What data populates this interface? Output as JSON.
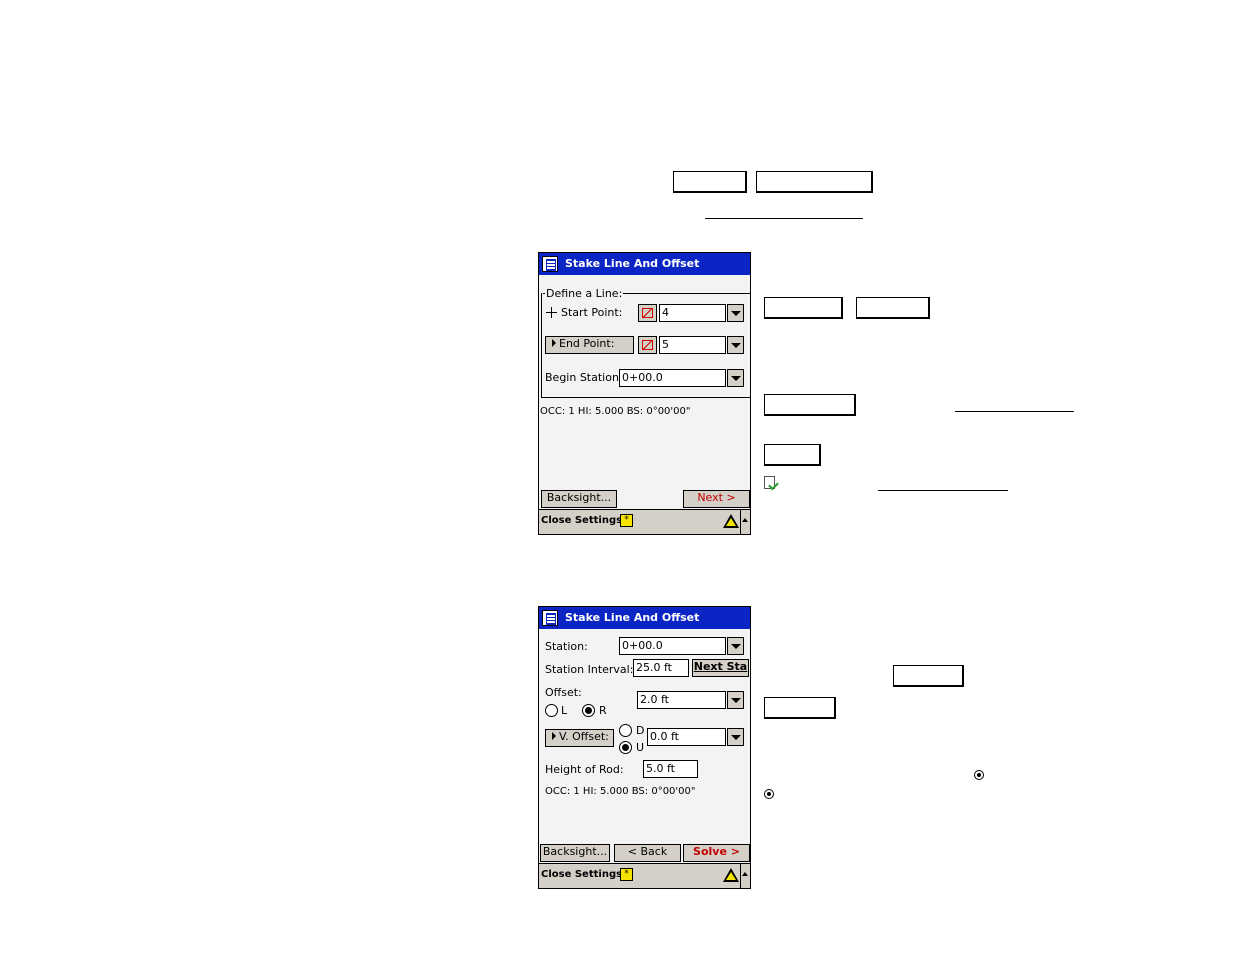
{
  "screen1": {
    "title": "Stake Line And Offset",
    "group_label": "Define a Line:",
    "start_point_label": "Start Point:",
    "start_point_value": "4",
    "end_point_label": "End Point:",
    "end_point_value": "5",
    "begin_station_label": "Begin Station:",
    "begin_station_value": "0+00.0",
    "status_text": "OCC: 1  HI: 5.000  BS: 0°00'00\"",
    "backsight_button": "Backsight...",
    "next_button": "Next >",
    "bottom_label": "Close Settings"
  },
  "screen2": {
    "title": "Stake Line And Offset",
    "station_label": "Station:",
    "station_value": "0+00.0",
    "interval_label": "Station Interval:",
    "interval_value": "25.0 ft",
    "next_sta_button": "Next Sta",
    "offset_label": "Offset:",
    "offset_value": "2.0 ft",
    "radio_l": "L",
    "radio_r": "R",
    "radio_d": "D",
    "radio_u": "U",
    "voffset_button": "V. Offset:",
    "voffset_value": "0.0 ft",
    "rod_label": "Height of Rod:",
    "rod_value": "5.0 ft",
    "status_text": "OCC: 1  HI: 5.000  BS: 0°00'00\"",
    "backsight_button": "Backsight...",
    "back_button": "< Back",
    "solve_button": "Solve >",
    "bottom_label": "Close Settings"
  }
}
